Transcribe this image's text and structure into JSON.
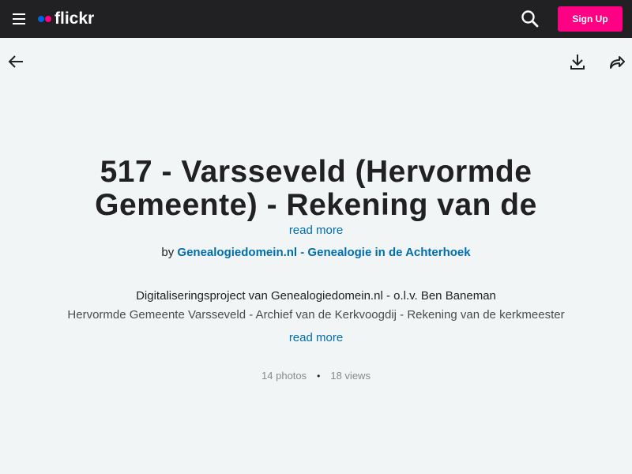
{
  "header": {
    "logo_text": "flickr",
    "signup_label": "Sign Up",
    "colors": {
      "bar": "#212124",
      "brand_blue": "#0063dc",
      "brand_pink": "#ff0084"
    }
  },
  "toolbar": {
    "back_icon": "arrow-left-icon",
    "download_icon": "download-icon",
    "share_icon": "share-arrow-icon"
  },
  "album": {
    "title": "517 - Varsseveld (Hervormde Gemeente) - Rekening van de",
    "read_more_title": "read more",
    "by_prefix": "by",
    "author": "Genealogiedomein.nl - Genealogie in de Achterhoek",
    "description_line1": "Digitaliseringsproject van Genealogiedomein.nl - o.l.v. Ben Baneman",
    "description_line2": "Hervormde Gemeente Varsseveld - Archief van de Kerkvoogdij - Rekening van de kerkmeester",
    "read_more_description": "read more",
    "photos": "14 photos",
    "separator": "•",
    "views": "18 views",
    "link_color": "#006dac"
  }
}
